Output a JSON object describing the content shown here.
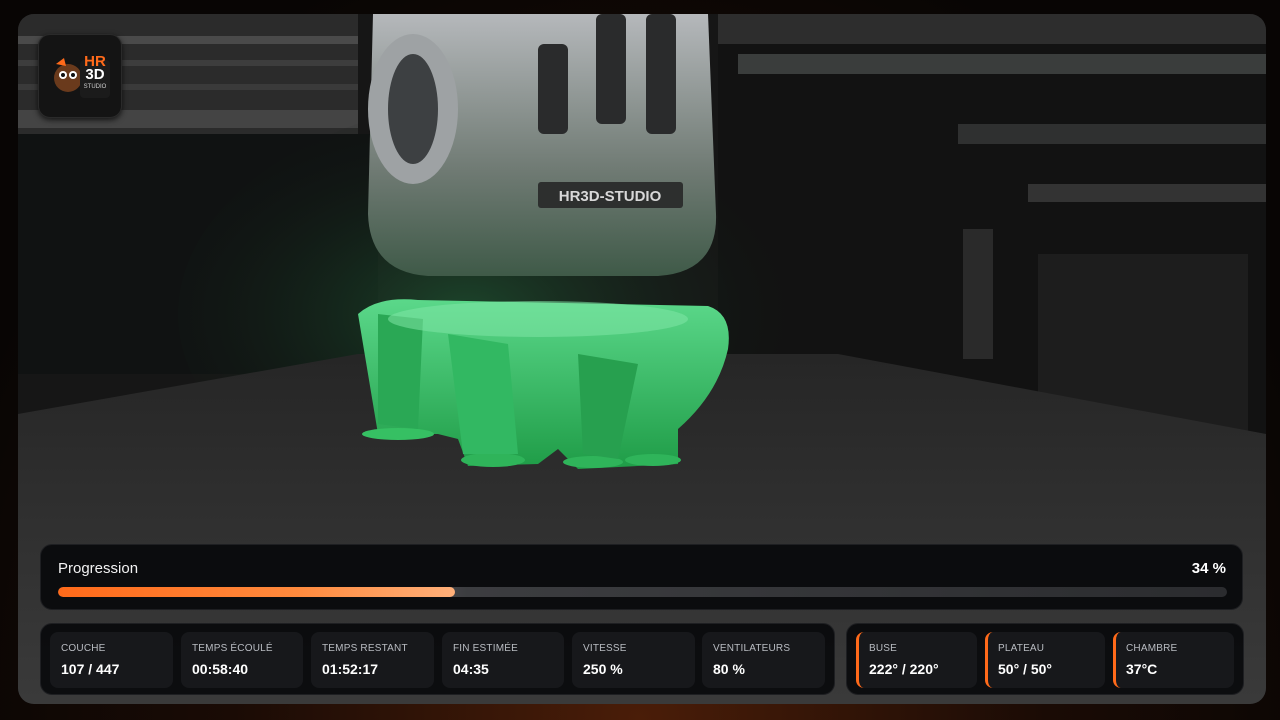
{
  "logo": {
    "text_top": "HR",
    "text_bottom": "3D",
    "text_small": "STUDIO"
  },
  "camera": {
    "nozzle_label": "HR3D-STUDIO"
  },
  "progress": {
    "label": "Progression",
    "percent_text": "34 %",
    "percent": 34
  },
  "stats": [
    {
      "label": "COUCHE",
      "value": "107 / 447"
    },
    {
      "label": "TEMPS ÉCOULÉ",
      "value": "00:58:40"
    },
    {
      "label": "TEMPS RESTANT",
      "value": "01:52:17"
    },
    {
      "label": "FIN ESTIMÉE",
      "value": "04:35"
    },
    {
      "label": "VITESSE",
      "value": "250 %"
    },
    {
      "label": "VENTILATEURS",
      "value": "80 %"
    }
  ],
  "temps": [
    {
      "label": "BUSE",
      "value": "222° / 220°"
    },
    {
      "label": "PLATEAU",
      "value": "50° / 50°"
    },
    {
      "label": "CHAMBRE",
      "value": "37°C"
    }
  ],
  "colors": {
    "accent": "#ff6a1a",
    "filament": "#2fbf5a"
  }
}
